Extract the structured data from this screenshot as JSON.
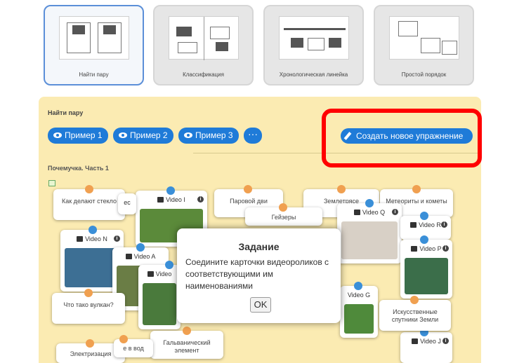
{
  "templates": [
    {
      "label": "Найти пару"
    },
    {
      "label": "Классификация"
    },
    {
      "label": "Хронологическая линейка"
    },
    {
      "label": "Простой порядок"
    }
  ],
  "panel": {
    "title": "Найти пару",
    "examples": [
      "Пример 1",
      "Пример 2",
      "Пример 3"
    ],
    "more_label": "···",
    "create_label": "Создать новое упражнение",
    "subtitle": "Почемучка. Часть 1",
    "collapse": "⌄"
  },
  "cards": {
    "text": [
      "Как делают стекло",
      "Паровой дви",
      "Гейзеры",
      "Землетрясе",
      "Метеориты и кометы",
      "Что тако вулкан?",
      "Искусственные спутники Земли",
      "Гальванический элемент",
      "Электризация",
      "е в вод"
    ],
    "video": [
      "Video I",
      "Video Q",
      "Video R",
      "Video N",
      "Video A",
      "Video P",
      "Video",
      "Video G",
      "Video J",
      "ec"
    ]
  },
  "modal": {
    "title": "Задание",
    "text": "Соедините карточки видеороликов с соответствующими им наименованиями",
    "ok": "OK"
  },
  "colors": {
    "accent": "#1f7bd8",
    "panel": "#fbebb2",
    "highlight": "#ff0000"
  }
}
